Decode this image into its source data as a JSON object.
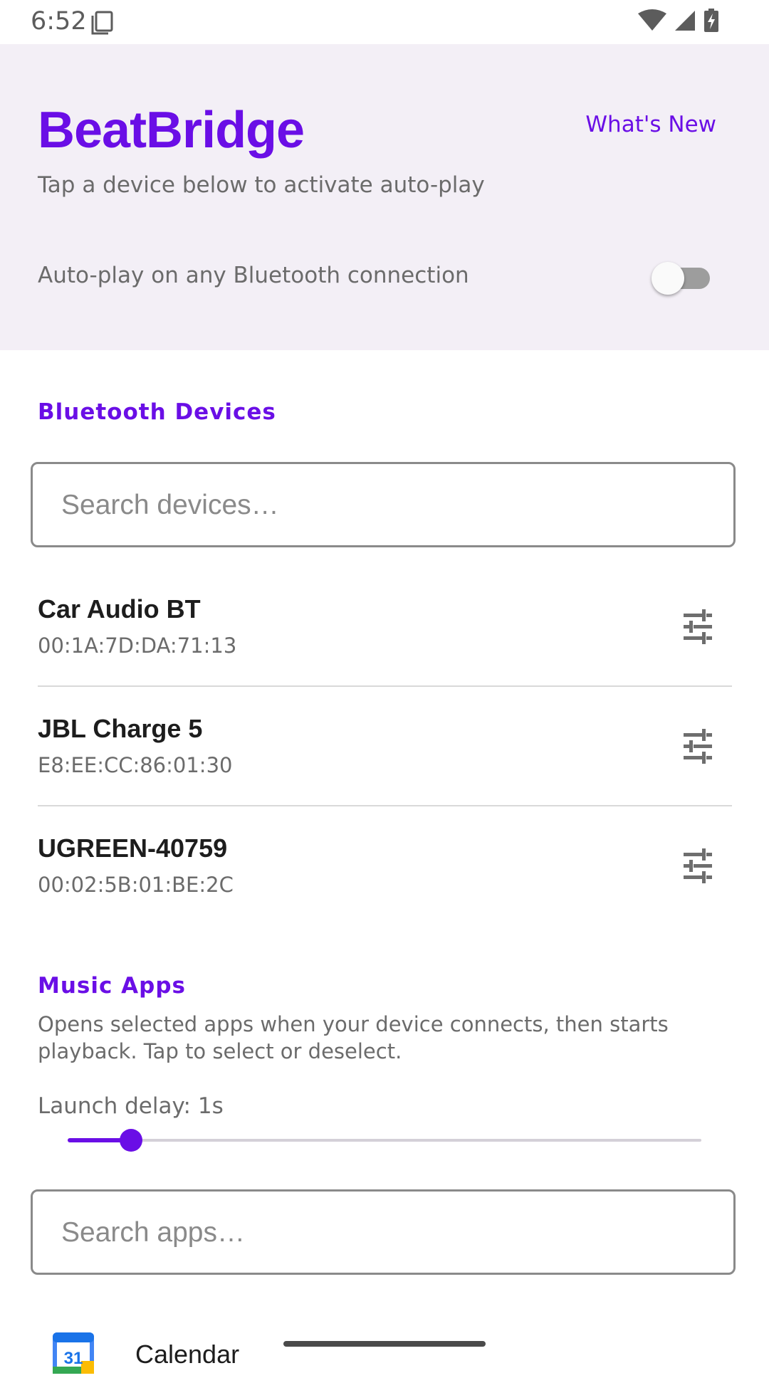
{
  "status_bar": {
    "time": "6:52"
  },
  "header": {
    "app_title": "BeatBridge",
    "whats_new": "What's New",
    "subtitle": "Tap a device below to activate auto-play",
    "autoplay_label": "Auto-play on any Bluetooth connection",
    "autoplay_enabled": false
  },
  "bluetooth": {
    "section_title": "Bluetooth Devices",
    "search_placeholder": "Search devices…",
    "devices": [
      {
        "name": "Car Audio BT",
        "mac": "00:1A:7D:DA:71:13"
      },
      {
        "name": "JBL Charge 5",
        "mac": "E8:EE:CC:86:01:30"
      },
      {
        "name": "UGREEN-40759",
        "mac": "00:02:5B:01:BE:2C"
      }
    ]
  },
  "music_apps": {
    "section_title": "Music Apps",
    "description": "Opens selected apps when your device connects, then starts playback. Tap to select or deselect.",
    "delay_label": "Launch delay: 1s",
    "delay_fraction": 0.1,
    "search_placeholder": "Search apps…",
    "apps": [
      {
        "name": "Calendar",
        "icon_text": "31"
      }
    ]
  },
  "colors": {
    "accent": "#6a0ee6",
    "header_bg": "#f3eff6"
  }
}
